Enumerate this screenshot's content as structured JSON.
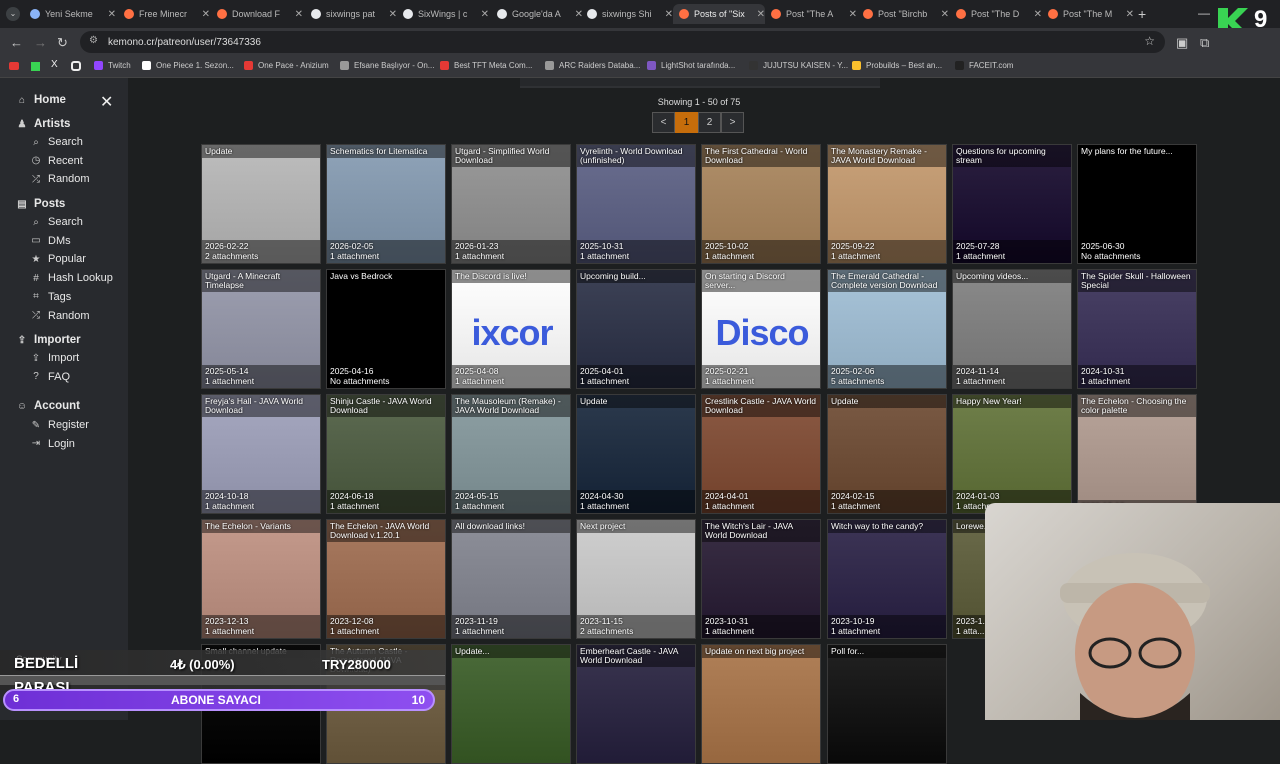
{
  "browser": {
    "tabs": [
      {
        "title": "Yeni Sekme",
        "color": "#8ab4f8"
      },
      {
        "title": "Free Minecr",
        "color": "#ff7043"
      },
      {
        "title": "Download F",
        "color": "#ff7043"
      },
      {
        "title": "sixwings pat",
        "color": "#e8eaed"
      },
      {
        "title": "SixWings | c",
        "color": "#e8eaed"
      },
      {
        "title": "Google'da A",
        "color": "#e8eaed"
      },
      {
        "title": "sixwings Shi",
        "color": "#e8eaed"
      },
      {
        "title": "Posts of \"Six",
        "color": "#ff7043"
      },
      {
        "title": "Post \"The A",
        "color": "#ff7043"
      },
      {
        "title": "Post \"Birchb",
        "color": "#ff7043"
      },
      {
        "title": "Post \"The D",
        "color": "#ff7043"
      },
      {
        "title": "Post \"The M",
        "color": "#ff7043"
      }
    ],
    "url": "kemono.cr/patreon/user/73647336",
    "bookmarks": [
      {
        "label": "Twitch",
        "color": "#9146ff"
      },
      {
        "label": "One Piece 1. Sezon...",
        "color": "#ffffff"
      },
      {
        "label": "One Pace - Anizium",
        "color": "#e53935"
      },
      {
        "label": "Efsane Başlıyor - On...",
        "color": "#999999"
      },
      {
        "label": "Best TFT Meta Com...",
        "color": "#e53935"
      },
      {
        "label": "ARC Raiders Databa...",
        "color": "#999999"
      },
      {
        "label": "LightShot tarafında...",
        "color": "#7e57c2"
      },
      {
        "label": "JUJUTSU KAISEN - Y...",
        "color": "#333333"
      },
      {
        "label": "Probuilds – Best an...",
        "color": "#fbc02d"
      },
      {
        "label": "FACEIT.com",
        "color": "#222222"
      }
    ]
  },
  "sidebar": {
    "home": "Home",
    "artists": "Artists",
    "artists_items": [
      "Search",
      "Recent",
      "Random"
    ],
    "posts": "Posts",
    "posts_items": [
      "Search",
      "DMs",
      "Popular",
      "Hash Lookup",
      "Tags",
      "Random"
    ],
    "importer": "Importer",
    "importer_items": [
      "Import",
      "FAQ"
    ],
    "account": "Account",
    "account_items": [
      "Register",
      "Login"
    ]
  },
  "pagination": {
    "showing": "Showing 1 - 50 of 75",
    "prev": "<",
    "pages": [
      "1",
      "2"
    ],
    "next": ">"
  },
  "posts": [
    {
      "title": "Update",
      "date": "2026-02-22",
      "att": "2 attachments",
      "bg": "#bdbdbd"
    },
    {
      "title": "Schematics for Litematica",
      "date": "2026-02-05",
      "att": "1 attachment",
      "bg": "#8fa3b8"
    },
    {
      "title": "Utgard - Simplified World Download",
      "date": "2026-01-23",
      "att": "1 attachment",
      "bg": "#9a9a9a"
    },
    {
      "title": "Vyrelinth - World Download (unfinished)",
      "date": "2025-10-31",
      "att": "1 attachment",
      "bg": "#6a6e8f"
    },
    {
      "title": "The First Cathedral - World Download",
      "date": "2025-10-02",
      "att": "1 attachment",
      "bg": "#b08f6a"
    },
    {
      "title": "The Monastery Remake - JAVA World Download",
      "date": "2025-09-22",
      "att": "1 attachment",
      "bg": "#c9a27a"
    },
    {
      "title": "Questions for upcoming stream",
      "date": "2025-07-28",
      "att": "1 attachment",
      "bg": "#2b2040"
    },
    {
      "title": "My plans for the future...",
      "date": "2025-06-30",
      "att": "No attachments",
      "bg": "#000000"
    },
    {
      "title": "Utgard - A Minecraft Timelapse",
      "date": "2025-05-14",
      "att": "1 attachment",
      "bg": "#9d9fb0"
    },
    {
      "title": "Java vs Bedrock",
      "date": "2025-04-16",
      "att": "No attachments",
      "bg": "#000000"
    },
    {
      "title": "The Discord is live!",
      "date": "2025-04-08",
      "att": "1 attachment",
      "bg": "#ffffff",
      "big": "ixcor"
    },
    {
      "title": "Upcoming build...",
      "date": "2025-04-01",
      "att": "1 attachment",
      "bg": "#3d4256"
    },
    {
      "title": "On starting a Discord server...",
      "date": "2025-02-21",
      "att": "1 attachment",
      "bg": "#ffffff",
      "big": "Disco"
    },
    {
      "title": "The Emerald Cathedral - Complete version Download",
      "date": "2025-02-06",
      "att": "5 attachments",
      "bg": "#a8c4d9"
    },
    {
      "title": "Upcoming videos...",
      "date": "2024-11-14",
      "att": "1 attachment",
      "bg": "#8a8a8a"
    },
    {
      "title": "The Spider Skull - Halloween Special",
      "date": "2024-10-31",
      "att": "1 attachment",
      "bg": "#4a4266"
    },
    {
      "title": "Freyja's Hall - JAVA World Download",
      "date": "2024-10-18",
      "att": "1 attachment",
      "bg": "#a6a8c0"
    },
    {
      "title": "Shinju Castle - JAVA World Download",
      "date": "2024-06-18",
      "att": "1 attachment",
      "bg": "#5d6b52"
    },
    {
      "title": "The Mausoleum (Remake) - JAVA World Download",
      "date": "2024-05-15",
      "att": "1 attachment",
      "bg": "#8ea0a4"
    },
    {
      "title": "Update",
      "date": "2024-04-30",
      "att": "1 attachment",
      "bg": "#2c3a4d"
    },
    {
      "title": "Crestlink Castle - JAVA World Download",
      "date": "2024-04-01",
      "att": "1 attachment",
      "bg": "#8b5a44"
    },
    {
      "title": "Update",
      "date": "2024-02-15",
      "att": "1 attachment",
      "bg": "#7a5a44"
    },
    {
      "title": "Happy New Year!",
      "date": "2024-01-03",
      "att": "1 attachment",
      "bg": "#6f7f4a"
    },
    {
      "title": "The Echelon - Choosing the color palette",
      "date": "2023-12-13",
      "att": "",
      "bg": "#b8a49a"
    },
    {
      "title": "The Echelon - Variants",
      "date": "2023-12-13",
      "att": "1 attachment",
      "bg": "#c49a8c"
    },
    {
      "title": "The Echelon - JAVA World Download v.1.20.1",
      "date": "2023-12-08",
      "att": "1 attachment",
      "bg": "#a87a60"
    },
    {
      "title": "All download links!",
      "date": "2023-11-19",
      "att": "1 attachment",
      "bg": "#8d8f99"
    },
    {
      "title": "Next project",
      "date": "2023-11-15",
      "att": "2 attachments",
      "bg": "#cfcfcf"
    },
    {
      "title": "The Witch's Lair - JAVA World Download",
      "date": "2023-10-31",
      "att": "1 attachment",
      "bg": "#3a2f45"
    },
    {
      "title": "Witch way to the candy?",
      "date": "2023-10-19",
      "att": "1 attachment",
      "bg": "#3d3556"
    },
    {
      "title": "Lorewe... World D...",
      "date": "2023-1...",
      "att": "1 atta...",
      "bg": "#6a6a4a"
    },
    {
      "title": "Update",
      "date": "",
      "att": "",
      "bg": "#222222"
    },
    {
      "title": "Small channel update",
      "date": "",
      "att": "",
      "bg": "#111111"
    },
    {
      "title": "The Autumn Castle - Remastered (JAVA Download)",
      "date": "",
      "att": "",
      "bg": "#7a6a50"
    },
    {
      "title": "Update...",
      "date": "",
      "att": "",
      "bg": "#4b6b3a"
    },
    {
      "title": "Emberheart Castle - JAVA World Download",
      "date": "",
      "att": "",
      "bg": "#3a3550"
    },
    {
      "title": "Update on next big project",
      "date": "",
      "att": "",
      "bg": "#b08058"
    },
    {
      "title": "Poll for...",
      "date": "",
      "att": "",
      "bg": "#222222"
    }
  ],
  "stream_overlay": {
    "label1": "BEDELLİ",
    "label2": "PARASI",
    "value": "4₺ (0.00%)",
    "goal": "TRY280000",
    "sub_left": "6",
    "sub_label": "ABONE SAYACI",
    "sub_right": "10",
    "ghost": "Community"
  },
  "logo": {
    "number": "9"
  }
}
